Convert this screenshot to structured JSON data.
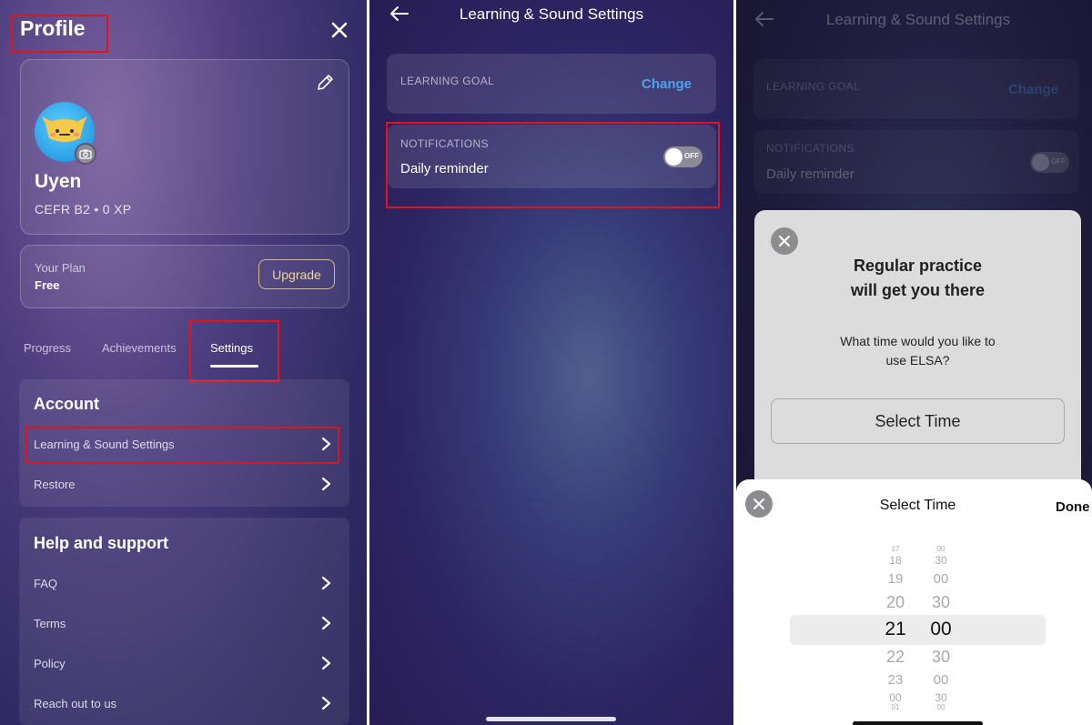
{
  "profile": {
    "title": "Profile",
    "user_name": "Uyen",
    "user_stats": "CEFR B2 • 0 XP",
    "plan_label": "Your Plan",
    "plan_value": "Free",
    "upgrade_label": "Upgrade",
    "tabs": [
      "Progress",
      "Achievements",
      "Settings"
    ],
    "active_tab": "Settings",
    "account": {
      "title": "Account",
      "items": [
        "Learning & Sound Settings",
        "Restore"
      ]
    },
    "help": {
      "title": "Help and support",
      "items": [
        "FAQ",
        "Terms",
        "Policy",
        "Reach out to us"
      ]
    }
  },
  "learning_settings": {
    "title": "Learning & Sound Settings",
    "goal_caption": "LEARNING GOAL",
    "change_label": "Change",
    "notifications_caption": "NOTIFICATIONS",
    "daily_reminder_label": "Daily reminder",
    "toggle_state": "OFF"
  },
  "reminder_modal": {
    "title_line1": "Regular practice",
    "title_line2": "will get you there",
    "question_line1": "What time would you like to",
    "question_line2": "use ELSA?",
    "select_button": "Select Time"
  },
  "time_sheet": {
    "title": "Select Time",
    "done_label": "Done",
    "hours": [
      "17",
      "18",
      "19",
      "20",
      "21",
      "22",
      "23",
      "00",
      "01"
    ],
    "minutes": [
      "00",
      "30",
      "00",
      "30",
      "00",
      "30",
      "00",
      "30",
      "00"
    ],
    "selected_hour": "21",
    "selected_minute": "00"
  },
  "colors": {
    "accent_blue": "#4aa3ef",
    "highlight_red": "#e0141d",
    "upgrade_gold": "#f0d592"
  }
}
